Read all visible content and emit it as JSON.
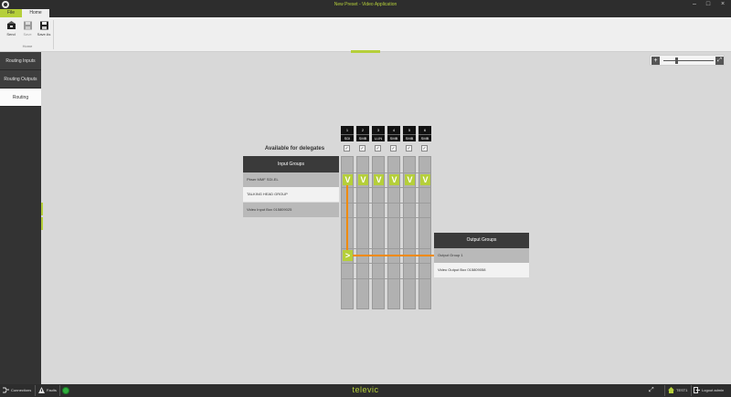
{
  "window": {
    "title": "New Preset - Video Application"
  },
  "ribbon": {
    "tabs": [
      "File",
      "Home"
    ],
    "buttons": [
      {
        "label": "Send"
      },
      {
        "label": "Save"
      },
      {
        "label": "Save As"
      }
    ],
    "group_label": "Home"
  },
  "sidebar": {
    "items": [
      {
        "label": "Routing Inputs"
      },
      {
        "label": "Routing Outputs"
      },
      {
        "label": "Routing"
      }
    ]
  },
  "routing": {
    "heading": "Available for delegates",
    "input_groups": {
      "header": "Input Groups",
      "rows": [
        "Pbser MMF SDI-EL",
        "TALKING HEAD GROUP",
        "Video Input Box 015809025"
      ]
    },
    "output_groups": {
      "header": "Output Groups",
      "rows": [
        "Output Group 1",
        "Video Output Box 015809058"
      ]
    },
    "columns": [
      {
        "num": "1",
        "tag": "SDI"
      },
      {
        "num": "2",
        "tag": "SMB"
      },
      {
        "num": "3",
        "tag": "U-IN"
      },
      {
        "num": "4",
        "tag": "SMB"
      },
      {
        "num": "5",
        "tag": "SMB"
      },
      {
        "num": "6",
        "tag": "SMB"
      }
    ],
    "checkmark": "✓",
    "route_mark": "V",
    "output_mark": ">"
  },
  "statusbar": {
    "connections": "Connections",
    "faults": "Faults",
    "brand": "televic",
    "test": "TEST1",
    "logout": "Logout admin"
  },
  "colors": {
    "accent": "#b5cf3a",
    "route": "#f08a00",
    "dark": "#2d2d2d"
  }
}
